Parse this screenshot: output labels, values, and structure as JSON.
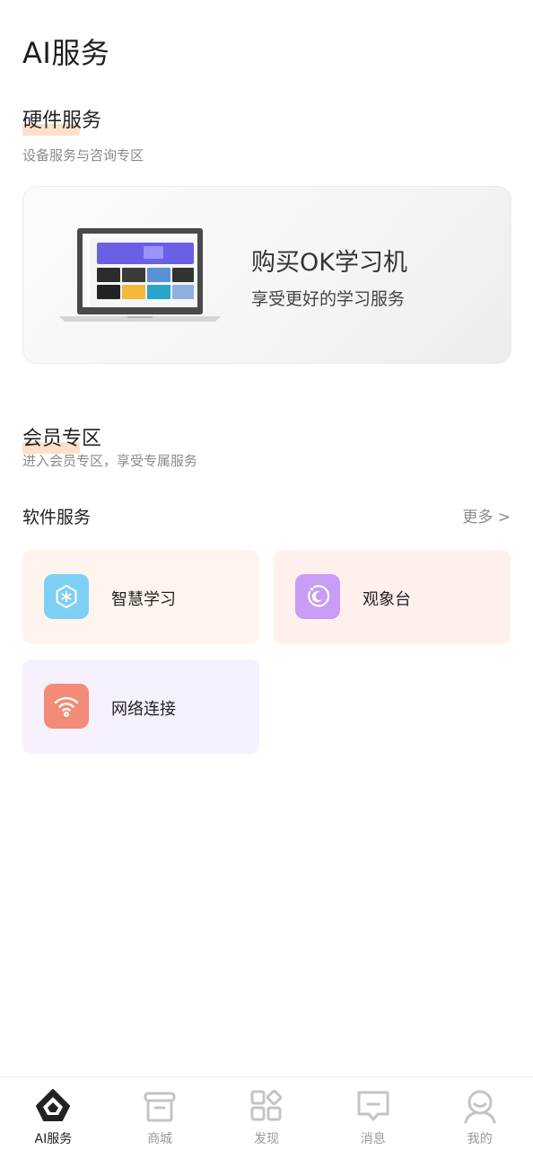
{
  "page": {
    "title": "AI服务"
  },
  "hardware": {
    "title": "硬件服务",
    "subtitle": "设备服务与咨询专区",
    "card_title": "购买OK学习机",
    "card_subtitle": "享受更好的学习服务"
  },
  "membership": {
    "title": "会员专区",
    "subtitle": "进入会员专区，享受专属服务"
  },
  "software": {
    "title": "软件服务",
    "more": "更多 >",
    "items": [
      {
        "label": "智慧学习",
        "icon": "snowflake-icon",
        "bg": "#fff5ee",
        "icon_bg": "#7ecff5"
      },
      {
        "label": "观象台",
        "icon": "moon-orbit-icon",
        "bg": "#fff0ee",
        "icon_bg": "#c99cf5"
      },
      {
        "label": "网络连接",
        "icon": "wifi-icon",
        "bg": "#f7f0fd",
        "icon_bg": "#f28b78"
      }
    ]
  },
  "tabbar": {
    "items": [
      {
        "label": "AI服务",
        "icon": "ai-home-icon",
        "active": true
      },
      {
        "label": "商城",
        "icon": "store-icon",
        "active": false
      },
      {
        "label": "发现",
        "icon": "discover-grid-icon",
        "active": false
      },
      {
        "label": "消息",
        "icon": "message-icon",
        "active": false
      },
      {
        "label": "我的",
        "icon": "profile-icon",
        "active": false
      }
    ]
  }
}
